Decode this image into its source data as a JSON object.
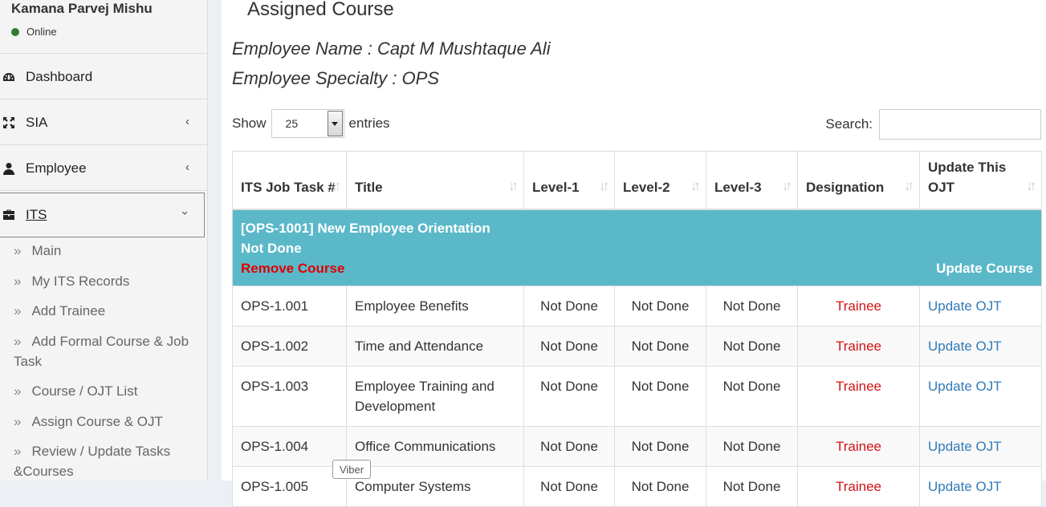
{
  "user": {
    "name": "Kamana Parvej Mishu",
    "status": "Online",
    "status_color": "#2f7d32"
  },
  "sidebar": {
    "menu": [
      {
        "label": "Dashboard",
        "icon": "dashboard-icon"
      },
      {
        "label": "SIA",
        "icon": "expand-icon"
      },
      {
        "label": "Employee",
        "icon": "user-icon"
      },
      {
        "label": "ITS",
        "icon": "briefcase-icon"
      }
    ],
    "submenu": [
      "Main",
      "My ITS Records",
      "Add Trainee",
      "Add Formal Course & Job Task",
      "Course / OJT List",
      "Assign Course & OJT",
      "Review / Update Tasks &Courses"
    ]
  },
  "tooltip": "Viber",
  "page": {
    "title": "Assigned Course",
    "employee_name": "Employee Name : Capt M Mushtaque Ali",
    "employee_specialty": "Employee Specialty : OPS"
  },
  "controls": {
    "show_label": "Show",
    "entries_value": "25",
    "entries_label": "entries",
    "search_label": "Search:",
    "search_value": ""
  },
  "table": {
    "headers": [
      "ITS Job Task #",
      "Title",
      "Level-1",
      "Level-2",
      "Level-3",
      "Designation",
      "Update This OJT"
    ],
    "group": {
      "title": "[OPS-1001] New Employee Orientation",
      "status": "Not Done",
      "remove": "Remove Course",
      "update": "Update Course"
    },
    "rows": [
      {
        "task": "OPS-1.001",
        "title": "Employee Benefits",
        "l1": "Not Done",
        "l2": "Not Done",
        "l3": "Not Done",
        "designation": "Trainee",
        "action": "Update OJT"
      },
      {
        "task": "OPS-1.002",
        "title": "Time and Attendance",
        "l1": "Not Done",
        "l2": "Not Done",
        "l3": "Not Done",
        "designation": "Trainee",
        "action": "Update OJT"
      },
      {
        "task": "OPS-1.003",
        "title": "Employee Training and Development",
        "l1": "Not Done",
        "l2": "Not Done",
        "l3": "Not Done",
        "designation": "Trainee",
        "action": "Update OJT"
      },
      {
        "task": "OPS-1.004",
        "title": "Office Communications",
        "l1": "Not Done",
        "l2": "Not Done",
        "l3": "Not Done",
        "designation": "Trainee",
        "action": "Update OJT"
      },
      {
        "task": "OPS-1.005",
        "title": "Computer Systems",
        "l1": "Not Done",
        "l2": "Not Done",
        "l3": "Not Done",
        "designation": "Trainee",
        "action": "Update OJT"
      }
    ]
  },
  "colors": {
    "group_bg": "#5bb8c9",
    "remove": "#e00000",
    "trainee": "#d11414",
    "link": "#337ab7"
  }
}
